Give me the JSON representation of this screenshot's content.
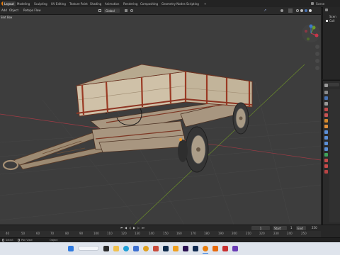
{
  "topbar": {
    "workspace_tabs": [
      "Layout",
      "Modeling",
      "Sculpting",
      "UV Editing",
      "Texture Paint",
      "Shading",
      "Animation",
      "Rendering",
      "Compositing",
      "Geometry Nodes",
      "Scripting"
    ],
    "active_tab": "Layout",
    "add_tab": "+",
    "scene_label": "Scene"
  },
  "header2": {
    "menu": [
      "Add",
      "Object"
    ],
    "retopo_label": "Retopo Flow",
    "orientation_label": "Global",
    "options_label": "Options"
  },
  "viewport": {
    "slot_label": "Slot Box",
    "grid_color": "#4a4a4a",
    "x_axis_color": "#a23b45",
    "y_axis_color": "#6b8e2a"
  },
  "outliner": {
    "rows": [
      "Scen",
      "Coll"
    ]
  },
  "timeline": {
    "ticks": [
      "40",
      "50",
      "60",
      "70",
      "80",
      "90",
      "100",
      "110",
      "120",
      "130",
      "140",
      "150",
      "160",
      "170",
      "180",
      "190",
      "200",
      "210",
      "220",
      "230",
      "240",
      "250"
    ],
    "current_frame": "1",
    "start_label": "Start",
    "start_value": "1",
    "end_label": "End",
    "end_value": "250"
  },
  "statusbar": {
    "left_label": "Select",
    "mid_label": "Pan View",
    "right_label": "Object"
  },
  "taskbar": {
    "apps": [
      "start-icon",
      "search-icon",
      "taskview-icon",
      "explorer-icon",
      "edge-icon",
      "store-icon",
      "chrome-icon",
      "mail-icon",
      "photoshop-icon",
      "illustrator-icon",
      "aftereffects-icon",
      "media-encoder-icon",
      "blender-icon",
      "vlc-icon",
      "app-icon-1",
      "app-icon-2"
    ]
  },
  "colors": {
    "accent": "#4772b3",
    "selection_orange": "#f19b2c",
    "wood": "#cfc1a8",
    "rust": "#8a3b26"
  }
}
